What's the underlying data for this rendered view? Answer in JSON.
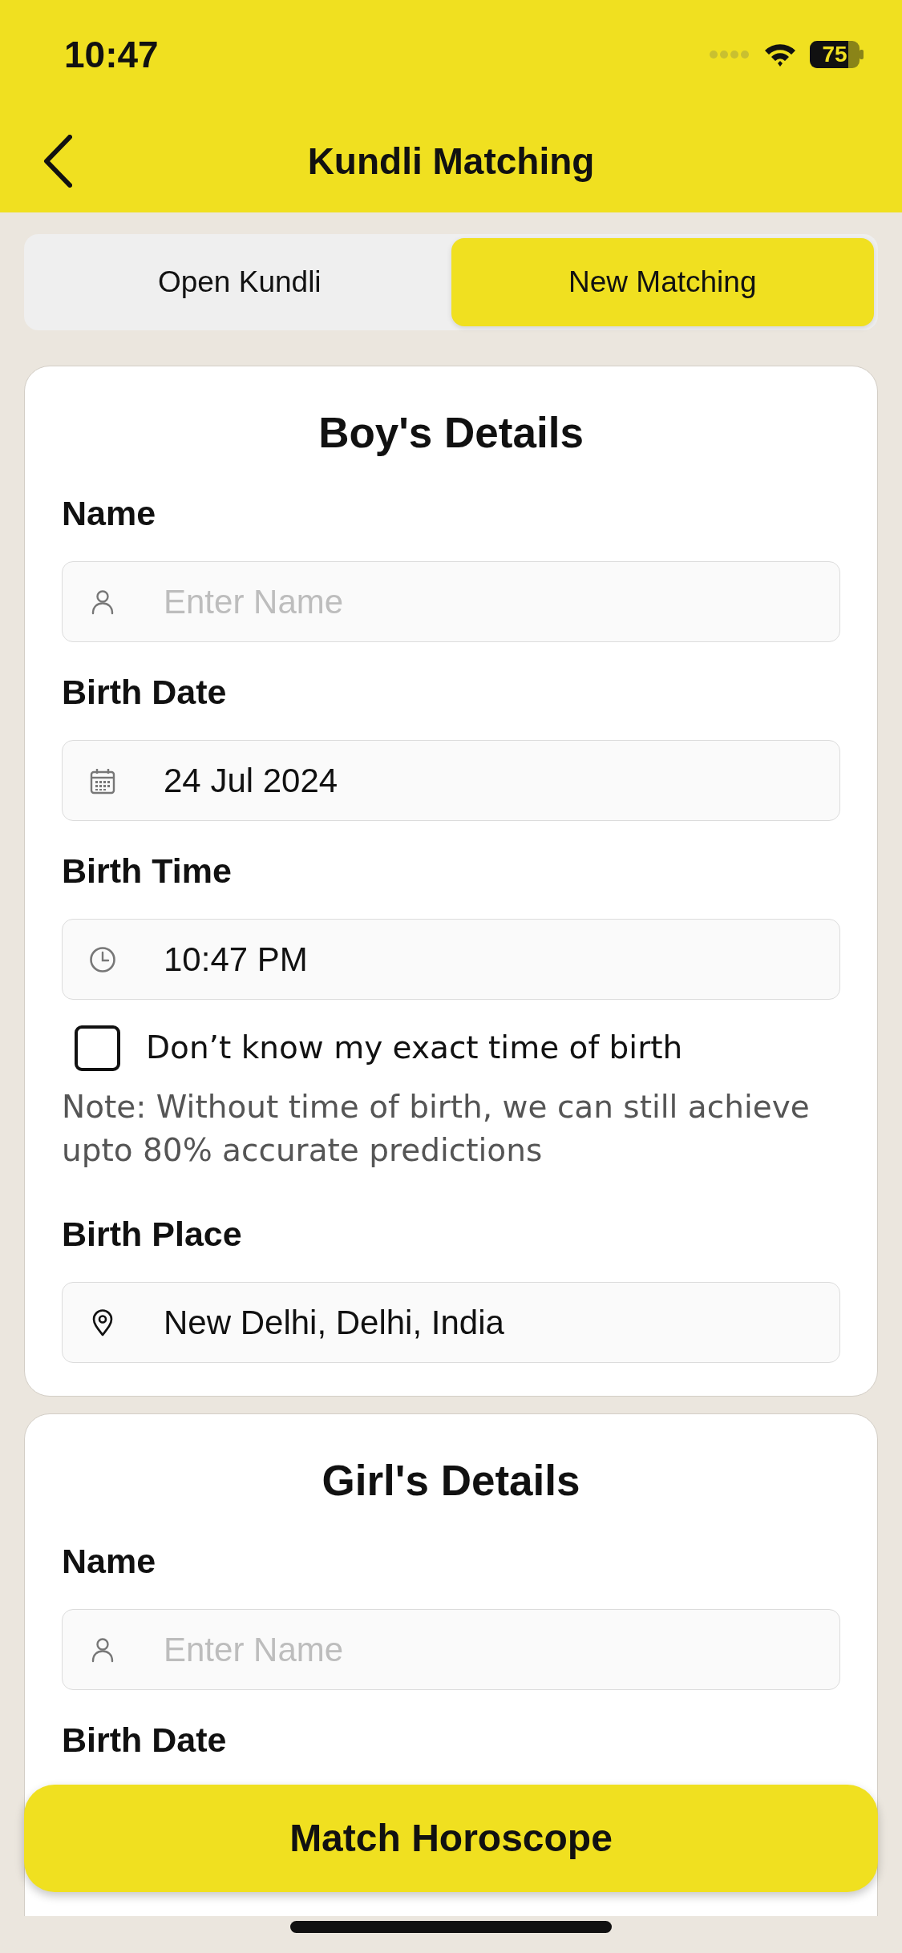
{
  "status_bar": {
    "time": "10:47",
    "battery": "75"
  },
  "header": {
    "title": "Kundli Matching"
  },
  "tabs": [
    {
      "label": "Open Kundli",
      "selected": false
    },
    {
      "label": "New Matching",
      "selected": true
    }
  ],
  "sections": [
    {
      "title": "Boy's Details",
      "fields": [
        {
          "kind": "name_input",
          "label": "Name",
          "placeholder": "Enter Name"
        },
        {
          "kind": "date_input",
          "label": "Birth Date",
          "value": "24 Jul 2024"
        },
        {
          "kind": "time_input",
          "label": "Birth Time",
          "value": "10:47 PM"
        },
        {
          "kind": "checkbox",
          "label": "Don’t know my exact time of birth",
          "checked": false
        },
        {
          "kind": "note",
          "text": "Note: Without time of birth, we can still achieve upto 80% accurate predictions"
        },
        {
          "kind": "place_input",
          "label": "Birth Place",
          "value": "New Delhi, Delhi, India"
        }
      ]
    },
    {
      "title": "Girl's Details",
      "fields": [
        {
          "kind": "name_input",
          "label": "Name",
          "placeholder": "Enter Name"
        },
        {
          "kind": "label",
          "label": "Birth Date"
        }
      ]
    }
  ],
  "action_button": {
    "label": "Match Horoscope"
  }
}
